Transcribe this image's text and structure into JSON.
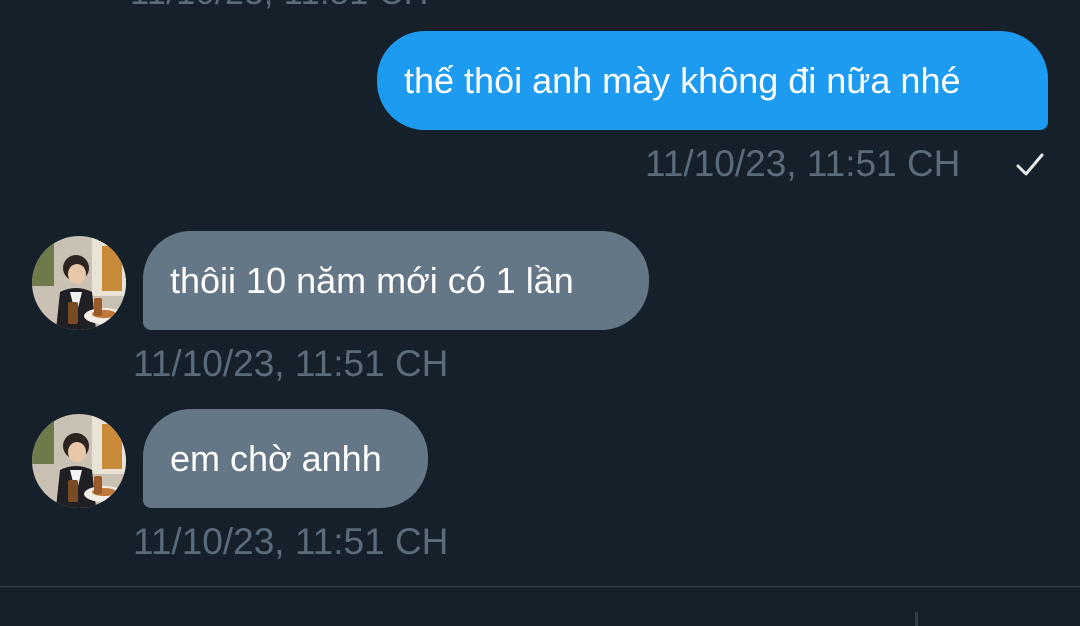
{
  "conversation": {
    "messages": [
      {
        "direction": "outgoing",
        "text": "thế thôi anh mày không đi nữa nhé",
        "timestamp": "11/10/23, 11:51 CH",
        "status_icon": "check-icon"
      },
      {
        "direction": "incoming",
        "text": "thôii 10 năm mới có 1 lần",
        "timestamp": "11/10/23, 11:51 CH",
        "avatar_icon": "avatar-photo"
      },
      {
        "direction": "incoming",
        "text": "em chờ anhh",
        "timestamp": "11/10/23, 11:51 CH",
        "avatar_icon": "avatar-photo"
      }
    ]
  },
  "colors": {
    "background": "#15202b",
    "outgoing_bubble": "#1d9bf0",
    "incoming_bubble": "#657786",
    "timestamp_text": "#5b6b7a",
    "message_text": "#ffffff"
  }
}
